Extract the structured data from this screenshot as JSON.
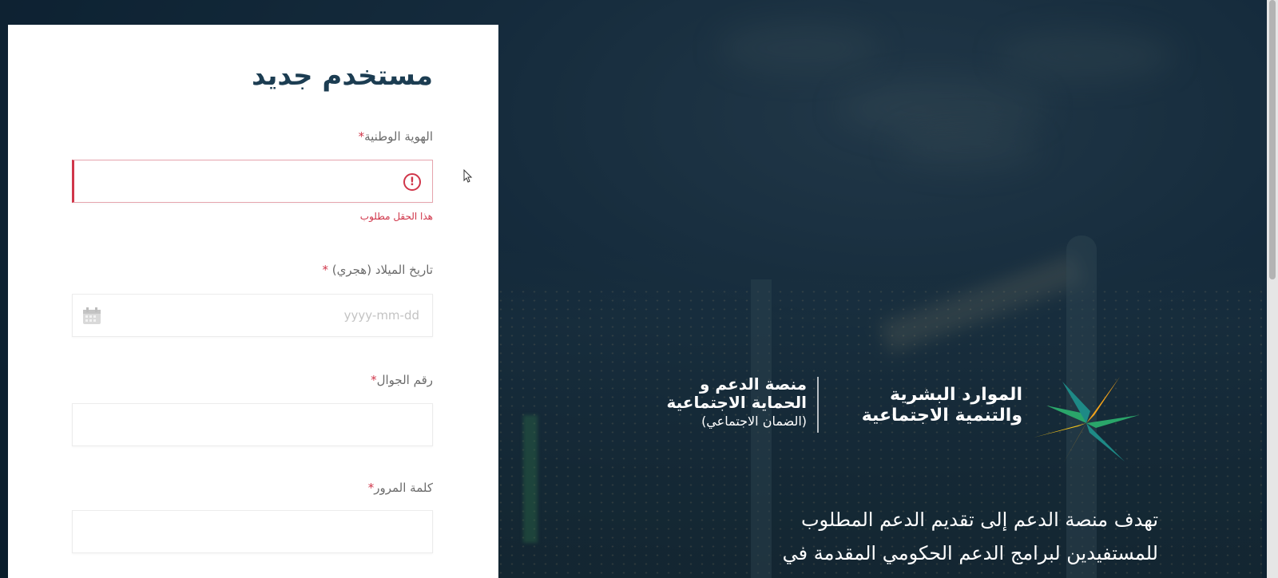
{
  "form": {
    "title": "مستخدم جديد",
    "national_id": {
      "label": "الهوية الوطنية",
      "required_mark": "*",
      "value": "",
      "error_icon": "exclamation-circle-icon",
      "error_message": "هذا الحقل مطلوب"
    },
    "birth_date": {
      "label": "تاريخ الميلاد (هجري)",
      "required_mark": "*",
      "placeholder": "yyyy-mm-dd",
      "icon": "calendar-icon"
    },
    "mobile": {
      "label": "رقم الجوال",
      "required_mark": "*",
      "value": ""
    },
    "password": {
      "label": "كلمة المرور",
      "required_mark": "*",
      "value": ""
    }
  },
  "branding": {
    "ministry_name": [
      "الموارد البشرية",
      "والتنمية الاجتماعية"
    ],
    "platform_name": [
      "منصة الدعم و",
      "الحماية الاجتماعية"
    ],
    "platform_subtitle": "(الضمان الاجتماعي)",
    "description": [
      "تهدف منصة الدعم إلى تقديم الدعم المطلوب",
      "للمستفيدين لبرامج الدعم الحكومي المقدمة في"
    ]
  },
  "colors": {
    "title": "#1c3d52",
    "error": "#d0364a",
    "panel": "#ffffff",
    "background": "#0d2233",
    "logo_green": "#2aa66a",
    "logo_teal": "#1e8a86",
    "logo_orange": "#f2a31b"
  }
}
